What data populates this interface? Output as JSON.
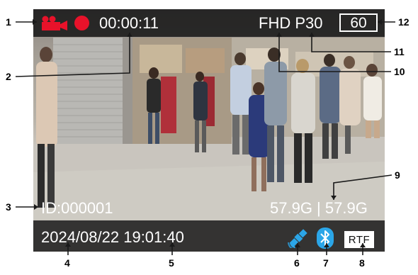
{
  "hud": {
    "recording": true,
    "timer": "00:00:11",
    "resolution": "FHD P30",
    "fps": "60",
    "device_id": "ID:000001",
    "storage": "57.9G | 57.9G",
    "datetime": "2024/08/22 19:01:40",
    "gps_icon": "satellite-icon",
    "bluetooth_icon": "bluetooth-icon",
    "rtf_badge": "RTF"
  },
  "callouts": [
    "1",
    "2",
    "3",
    "4",
    "5",
    "6",
    "7",
    "8",
    "9",
    "10",
    "11",
    "12"
  ],
  "colors": {
    "record_red": "#e8122a",
    "icon_blue": "#2ba6e8",
    "overlay": "#191919",
    "hud_text": "#ffffff"
  }
}
